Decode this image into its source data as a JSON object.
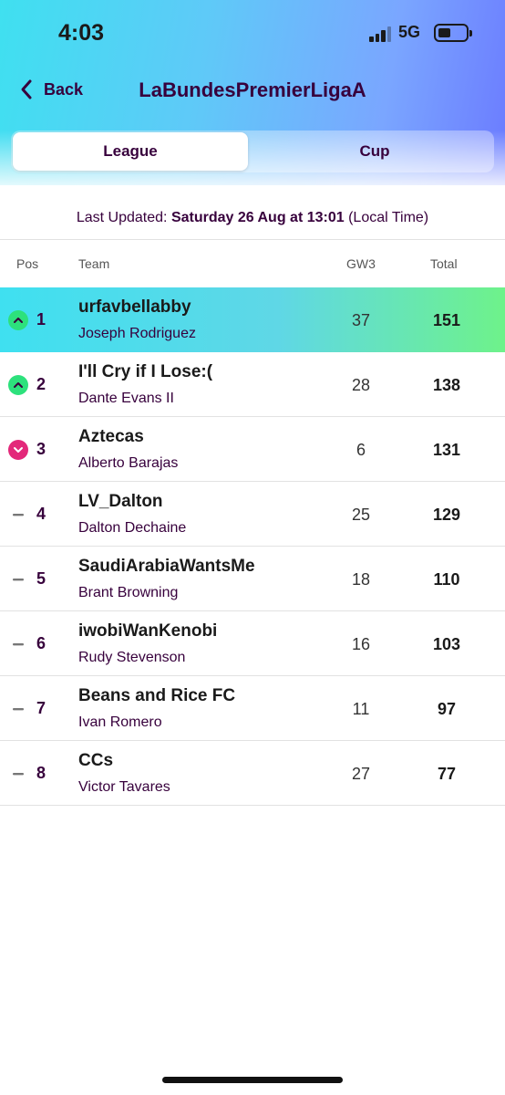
{
  "status": {
    "time": "4:03",
    "network": "5G"
  },
  "nav": {
    "back_label": "Back",
    "title": "LaBundesPremierLigaA"
  },
  "tabs": [
    {
      "label": "League",
      "active": true
    },
    {
      "label": "Cup",
      "active": false
    }
  ],
  "updated": {
    "prefix": "Last Updated:",
    "when": "Saturday 26 Aug at 13:01",
    "suffix": "(Local Time)"
  },
  "columns": {
    "pos": "Pos",
    "team": "Team",
    "gw": "GW3",
    "total": "Total"
  },
  "rows": [
    {
      "pos": "1",
      "team": "urfavbellabby",
      "manager": "Joseph Rodriguez",
      "gw": "37",
      "total": "151",
      "movement": "up"
    },
    {
      "pos": "2",
      "team": "I'll Cry if I Lose:(",
      "manager": "Dante Evans II",
      "gw": "28",
      "total": "138",
      "movement": "up"
    },
    {
      "pos": "3",
      "team": "Aztecas",
      "manager": "Alberto Barajas",
      "gw": "6",
      "total": "131",
      "movement": "down"
    },
    {
      "pos": "4",
      "team": "LV_Dalton",
      "manager": "Dalton Dechaine",
      "gw": "25",
      "total": "129",
      "movement": "same"
    },
    {
      "pos": "5",
      "team": "SaudiArabiaWantsMe",
      "manager": "Brant Browning",
      "gw": "18",
      "total": "110",
      "movement": "same"
    },
    {
      "pos": "6",
      "team": "iwobiWanKenobi",
      "manager": "Rudy Stevenson",
      "gw": "16",
      "total": "103",
      "movement": "same"
    },
    {
      "pos": "7",
      "team": "Beans and Rice FC",
      "manager": "Ivan Romero",
      "gw": "11",
      "total": "97",
      "movement": "same"
    },
    {
      "pos": "8",
      "team": "CCs",
      "manager": "Victor Tavares",
      "gw": "27",
      "total": "77",
      "movement": "same"
    }
  ],
  "colors": {
    "primary": "#37003c",
    "up": "#2de17c",
    "down": "#e3287a",
    "highlight_start": "#3fe0f0",
    "highlight_end": "#6ef28a"
  }
}
